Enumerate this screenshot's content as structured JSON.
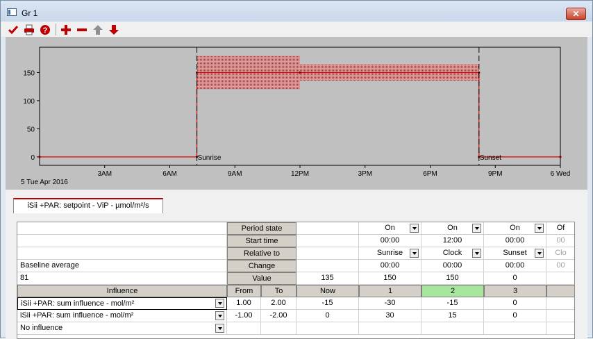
{
  "window": {
    "title": "Gr 1",
    "close_label": "✕"
  },
  "toolbar": {
    "icons": [
      "check-icon",
      "print-icon",
      "help-icon",
      "add-row-icon",
      "remove-row-icon",
      "move-up-icon",
      "move-down-icon"
    ]
  },
  "chart_data": {
    "type": "line",
    "x_ticks": [
      "3AM",
      "6AM",
      "9AM",
      "12PM",
      "3PM",
      "6PM",
      "9PM",
      "6 Wed"
    ],
    "x_start_label": "5 Tue Apr 2016",
    "y_ticks": [
      0,
      50,
      100,
      150
    ],
    "ylim": [
      -15,
      195
    ],
    "series": [
      {
        "x": [
          "00:00",
          "07:15",
          "07:15",
          "12:00",
          "20:15",
          "20:15",
          "24:00"
        ],
        "y": [
          0,
          0,
          150,
          150,
          150,
          0,
          0
        ]
      }
    ],
    "bands": [
      {
        "from": "07:15",
        "to": "12:00",
        "low": 120,
        "high": 180
      },
      {
        "from": "12:00",
        "to": "20:15",
        "low": 135,
        "high": 165
      }
    ],
    "annotations": [
      "Sunrise",
      "Sunset"
    ],
    "colors": {
      "line": "#e00000",
      "band": "#c0504d",
      "background": "#c0c0c0"
    }
  },
  "tab": {
    "label": "iSii +PAR: setpoint - ViP - µmol/m²/s"
  },
  "grid": {
    "row_labels": {
      "period_state": "Period state",
      "start_time": "Start time",
      "relative_to": "Relative to",
      "change": "Change",
      "value": "Value"
    },
    "baseline_label": "Baseline average",
    "baseline_value": "81",
    "value_now": "135",
    "periods": [
      {
        "state": "On",
        "start": "00:00",
        "relative": "Sunrise",
        "change": "00:00",
        "value": "150"
      },
      {
        "state": "On",
        "start": "12:00",
        "relative": "Clock",
        "change": "00:00",
        "value": "150"
      },
      {
        "state": "On",
        "start": "00:00",
        "relative": "Sunset",
        "change": "00:00",
        "value": "0"
      },
      {
        "state": "Of",
        "start": "00",
        "relative": "Clo",
        "change": "00",
        "value": ""
      }
    ],
    "influence_header": {
      "influence": "Influence",
      "from": "From",
      "to": "To",
      "now": "Now",
      "p1": "1",
      "p2": "2",
      "p3": "3"
    },
    "influences": [
      {
        "name": "iSii +PAR: sum influence - mol/m²",
        "from": "1.00",
        "to": "2.00",
        "now": "-15",
        "p1": "-30",
        "p2": "-15",
        "p3": "0"
      },
      {
        "name": "iSii +PAR: sum influence - mol/m²",
        "from": "-1.00",
        "to": "-2.00",
        "now": "0",
        "p1": "30",
        "p2": "15",
        "p3": "0"
      },
      {
        "name": "No influence",
        "from": "",
        "to": "",
        "now": "",
        "p1": "",
        "p2": "",
        "p3": ""
      }
    ]
  }
}
